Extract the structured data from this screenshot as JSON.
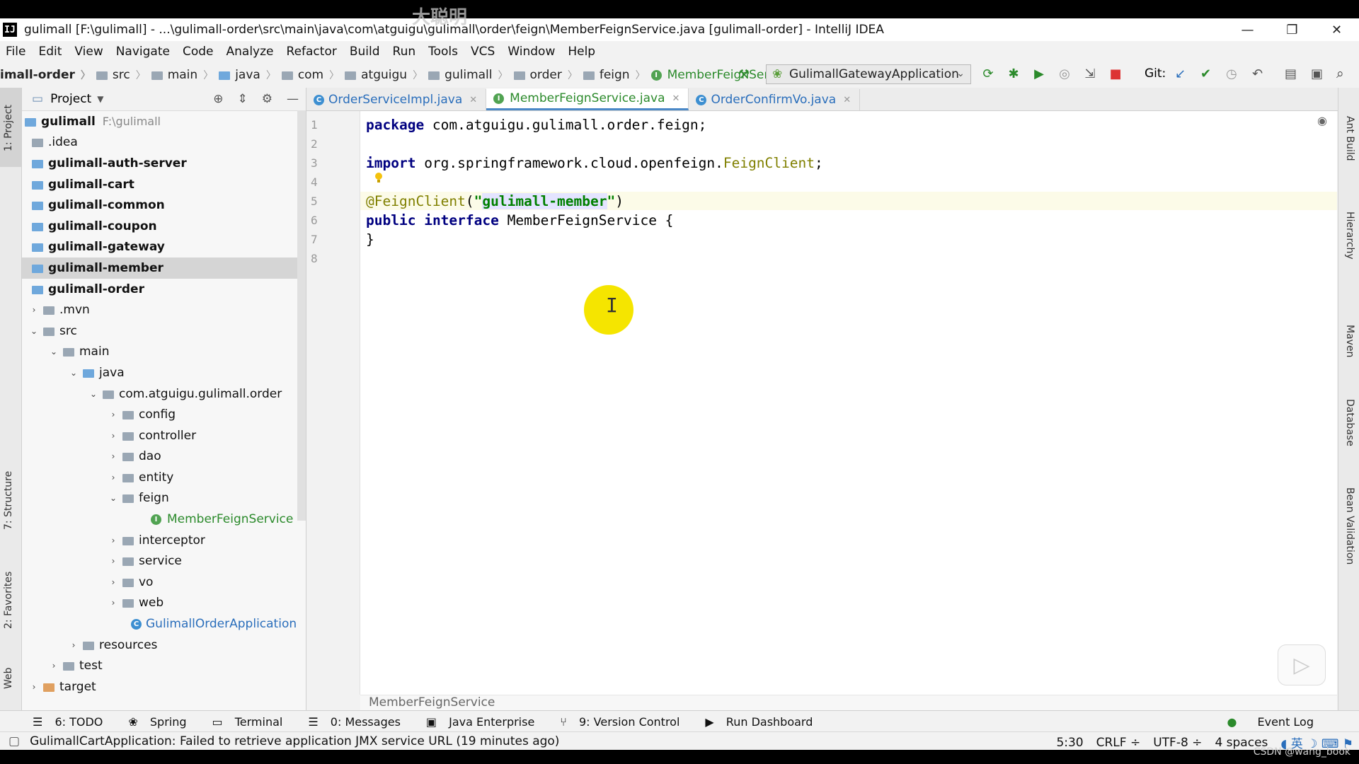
{
  "window": {
    "title": "gulimall [F:\\gulimall] - ...\\gulimall-order\\src\\main\\java\\com\\atguigu\\gulimall\\order\\feign\\MemberFeignService.java [gulimall-order] - IntelliJ IDEA",
    "app_icon": "IJ",
    "watermark": "大聪明",
    "minimize": "—",
    "restore": "❐",
    "close": "✕"
  },
  "menu": [
    "File",
    "Edit",
    "View",
    "Navigate",
    "Code",
    "Analyze",
    "Refactor",
    "Build",
    "Run",
    "Tools",
    "VCS",
    "Window",
    "Help"
  ],
  "navbar": {
    "module": "imall-order",
    "crumbs": [
      "src",
      "main",
      "java",
      "com",
      "atguigu",
      "gulimall",
      "order",
      "feign"
    ],
    "file": "MemberFeignService",
    "run_config": "GulimallGatewayApplication",
    "git_label": "Git:"
  },
  "project": {
    "header": "Project",
    "rows": [
      {
        "label": "gulimall",
        "hint": "F:\\gulimall"
      },
      {
        "label": ".idea"
      },
      {
        "label": "gulimall-auth-server"
      },
      {
        "label": "gulimall-cart"
      },
      {
        "label": "gulimall-common"
      },
      {
        "label": "gulimall-coupon"
      },
      {
        "label": "gulimall-gateway"
      },
      {
        "label": "gulimall-member"
      },
      {
        "label": "gulimall-order"
      },
      {
        "label": ".mvn"
      },
      {
        "label": "src"
      },
      {
        "label": "main"
      },
      {
        "label": "java"
      },
      {
        "label": "com.atguigu.gulimall.order"
      },
      {
        "label": "config"
      },
      {
        "label": "controller"
      },
      {
        "label": "dao"
      },
      {
        "label": "entity"
      },
      {
        "label": "feign"
      },
      {
        "label": "MemberFeignService"
      },
      {
        "label": "interceptor"
      },
      {
        "label": "service"
      },
      {
        "label": "vo"
      },
      {
        "label": "web"
      },
      {
        "label": "GulimallOrderApplication"
      },
      {
        "label": "resources"
      },
      {
        "label": "test"
      },
      {
        "label": "target"
      }
    ]
  },
  "tool_stripes": {
    "left": [
      "1: Project",
      "7: Structure",
      "2: Favorites",
      "Web"
    ],
    "right": [
      "Ant Build",
      "Hierarchy",
      "Maven",
      "Database",
      "Bean Validation"
    ]
  },
  "tabs": [
    {
      "label": "OrderServiceImpl.java",
      "badge": "C"
    },
    {
      "label": "MemberFeignService.java",
      "badge": "I"
    },
    {
      "label": "OrderConfirmVo.java",
      "badge": "C"
    }
  ],
  "editor": {
    "line_numbers": [
      "1",
      "2",
      "3",
      "4",
      "5",
      "6",
      "7",
      "8"
    ],
    "code": {
      "l1_kw": "package",
      "l1_rest": " com.atguigu.gulimall.order.feign;",
      "l3_kw": "import",
      "l3_pre": " org.springframework.cloud.openfeign.",
      "l3_ref": "FeignClient",
      "l3_end": ";",
      "l5_ann": "@FeignClient",
      "l5_open": "(",
      "l5_q1": "\"",
      "l5_str": "gulimall-member",
      "l5_q2": "\"",
      "l5_close": ")",
      "l6_kw1": "public",
      "l6_kw2": "interface",
      "l6_rest": " MemberFeignService {",
      "l7": "}"
    },
    "bottom_breadcrumb": "MemberFeignService"
  },
  "bottom_tools": [
    "6: TODO",
    "Spring",
    "Terminal",
    "0: Messages",
    "Java Enterprise",
    "9: Version Control",
    "Run Dashboard"
  ],
  "event_log": "Event Log",
  "status": {
    "message": "GulimallCartApplication: Failed to retrieve application JMX service URL (19 minutes ago)",
    "position": "5:30",
    "line_sep": "CRLF ÷",
    "encoding": "UTF-8 ÷",
    "indent": "4 spaces",
    "ime": "英"
  },
  "footer_credit": "CSDN @wang_book"
}
